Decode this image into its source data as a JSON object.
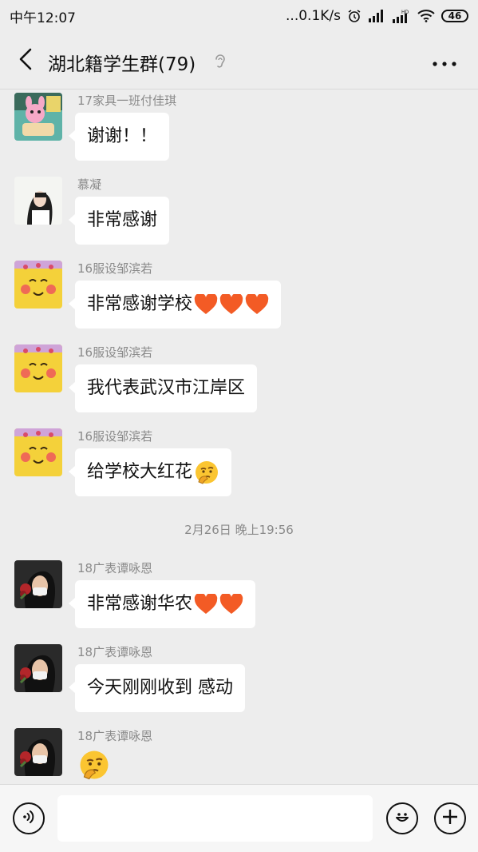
{
  "status_bar": {
    "time": "中午12:07",
    "network_speed": "...0.1K/s",
    "battery": "46"
  },
  "header": {
    "title": "湖北籍学生群(79)"
  },
  "messages": [
    {
      "sender": "17家具一班付佳琪",
      "text": "谢谢！！"
    },
    {
      "sender": "慕凝",
      "text": "非常感谢"
    },
    {
      "sender": "16服设邹滨若",
      "text": "非常感谢学校",
      "hearts": 3
    },
    {
      "sender": "16服设邹滨若",
      "text": "我代表武汉市江岸区"
    },
    {
      "sender": "16服设邹滨若",
      "text": "给学校大红花",
      "emoji": "thinking-face"
    },
    {
      "sender": "18广表谭咏恩",
      "text": "非常感谢华农",
      "hearts": 2
    },
    {
      "sender": "18广表谭咏恩",
      "text": "今天刚刚收到 感动"
    },
    {
      "sender": "18广表谭咏恩",
      "text": "",
      "emoji": "thinking-face"
    }
  ],
  "timestamp": "2月26日 晚上19:56",
  "input": {
    "value": "",
    "placeholder": ""
  },
  "colors": {
    "background": "#ededed",
    "bubble": "#ffffff",
    "heart": "#f35b25",
    "meta_text": "#8a8a8a"
  },
  "icons": {
    "back": "back-arrow-icon",
    "ear": "ear-icon",
    "more": "more-dots-icon",
    "voice": "voice-icon",
    "emoji": "smiley-icon",
    "plus": "plus-icon"
  }
}
